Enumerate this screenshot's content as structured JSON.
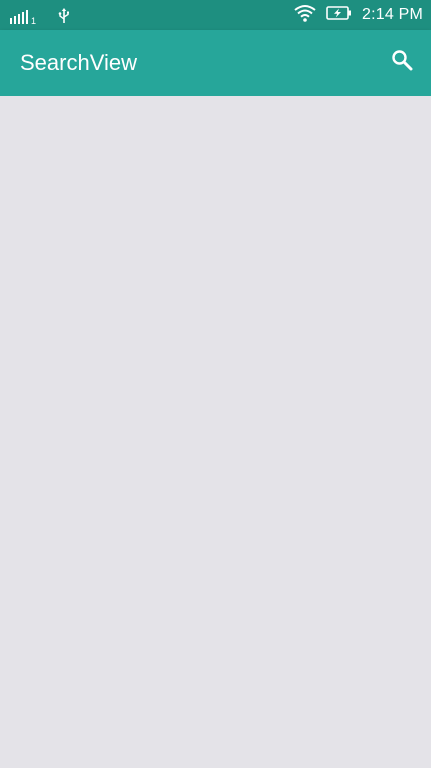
{
  "status_bar": {
    "sim_label": "1",
    "time": "2:14 PM",
    "icons": [
      "signal-icon",
      "usb-icon",
      "wifi-icon",
      "battery-charging-icon"
    ]
  },
  "app_bar": {
    "title": "SearchView",
    "action_icon": "search-icon"
  },
  "colors": {
    "status_bar": "#1e8f80",
    "app_bar": "#26a69a",
    "background": "#e4e3e8",
    "on_primary": "#ffffff"
  }
}
